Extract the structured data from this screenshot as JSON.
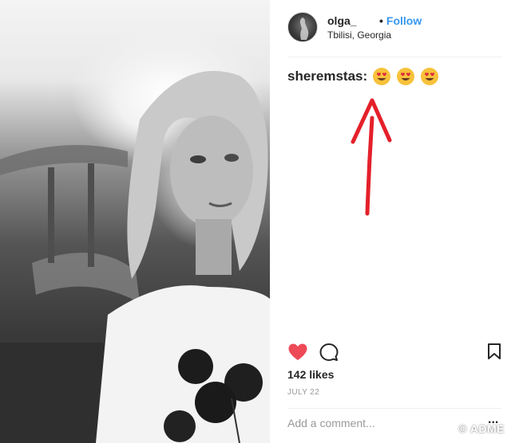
{
  "post": {
    "username": "olga_",
    "follow_dot": "•",
    "follow_label": "Follow",
    "location": "Tbilisi, Georgia",
    "comment_user": "sheremstas:",
    "comment_emojis": [
      "heart-eyes-emoji",
      "heart-eyes-emoji",
      "heart-eyes-emoji"
    ],
    "likes": "142 likes",
    "date": "JULY 22",
    "add_comment_placeholder": "Add a comment...",
    "more_label": "..."
  },
  "watermark": "© ADME",
  "icons": {
    "like": "heart-icon",
    "comment": "comment-bubble-icon",
    "save": "bookmark-icon"
  },
  "colors": {
    "follow": "#3897f0",
    "like": "#ed4956",
    "arrow": "#e4202a",
    "muted": "#999999"
  }
}
